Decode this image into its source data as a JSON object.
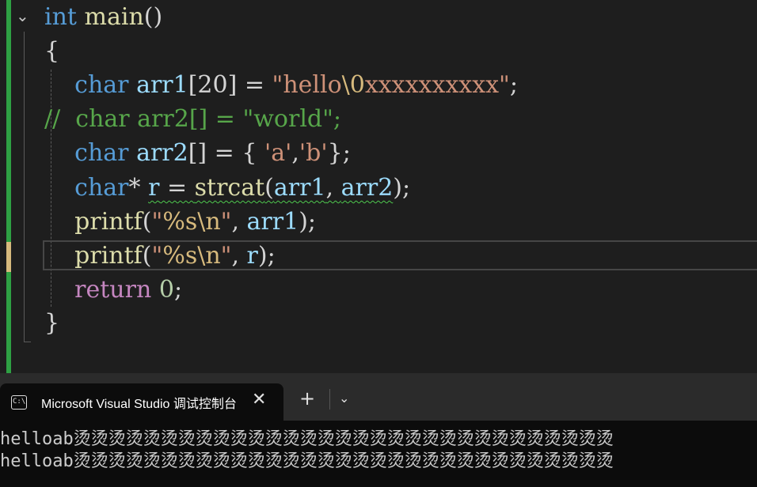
{
  "editor": {
    "lines": {
      "l1": {
        "kw": "int",
        "fn": "main",
        "rest": "()"
      },
      "l2": {
        "text": "{"
      },
      "l3": {
        "type": "char",
        "var": "arr1",
        "mid": "[20] = ",
        "str_a": "\"hello",
        "esc": "\\0",
        "str_b": "xxxxxxxxxx\"",
        "end": ";"
      },
      "l4": {
        "text": "//  char arr2[] = \"world\";"
      },
      "l5": {
        "type": "char",
        "var": "arr2",
        "mid": "[] = { ",
        "str_a": "'a'",
        "comma": ",",
        "str_b": "'b'",
        "end": "};"
      },
      "l6": {
        "type": "char",
        "mid1": "* ",
        "var": "r",
        "mid2": " = ",
        "fn": "strcat",
        "open": "(",
        "arg1": "arr1",
        "sep": ", ",
        "arg2": "arr2",
        "close": ");"
      },
      "l7": {
        "fn": "printf",
        "open": "(",
        "str_a": "\"",
        "fmt": "%s",
        "esc": "\\n",
        "str_b": "\"",
        "sep": ", ",
        "arg": "arr1",
        "end": ");"
      },
      "l8": {
        "fn": "printf",
        "open": "(",
        "str_a": "\"",
        "fmt": "%s",
        "esc": "\\n",
        "str_b": "\"",
        "sep": ", ",
        "arg": "r",
        "end": ");"
      },
      "l9": {
        "ctl": "return",
        "space": " ",
        "num": "0",
        "end": ";"
      },
      "l10": {
        "text": "}"
      }
    }
  },
  "terminal": {
    "tab_title": "Microsoft Visual Studio 调试控制台",
    "icon_text": "C:\\",
    "close_glyph": "✕",
    "add_glyph": "+",
    "dropdown_glyph": "⌄",
    "output": [
      "helloab烫烫烫烫烫烫烫烫烫烫烫烫烫烫烫烫烫烫烫烫烫烫烫烫烫烫烫烫烫烫烫",
      "helloab烫烫烫烫烫烫烫烫烫烫烫烫烫烫烫烫烫烫烫烫烫烫烫烫烫烫烫烫烫烫烫"
    ]
  },
  "colors": {
    "editor_bg": "#1e1e1e",
    "keyword": "#569cd6",
    "string": "#ce9178",
    "comment": "#57a64a",
    "change_bar": "#2ea043"
  },
  "icons": [
    "chevron-down-icon",
    "console-icon",
    "close-icon",
    "add-icon"
  ]
}
